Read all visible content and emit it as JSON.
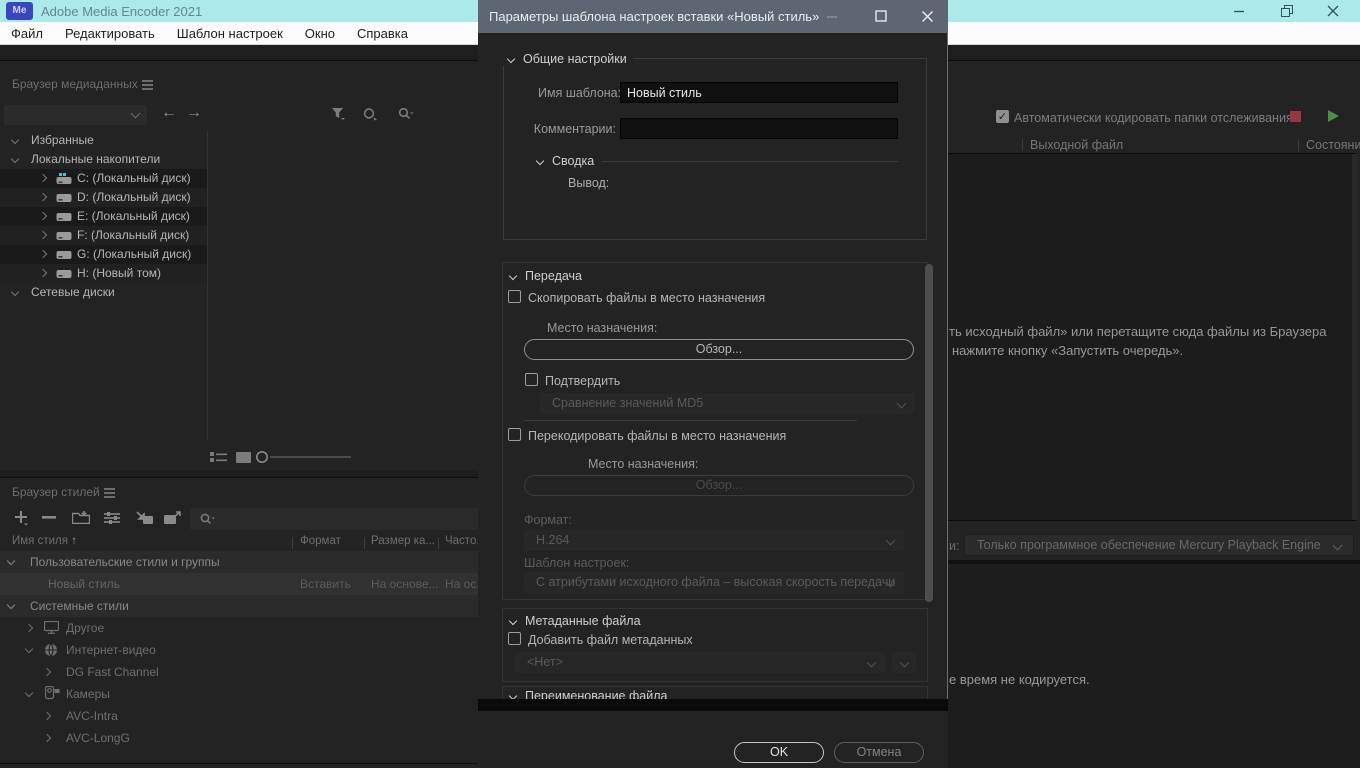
{
  "colors": {
    "titlebar_accent": "#abe9eb",
    "dialog_titlebar": "#5c6773",
    "panel_bg": "#232323",
    "stop_red": "#96393c",
    "play_green": "#4a8f46",
    "logo_blue": "#3a45c0",
    "drive_accent_cyan": "#35c8d8"
  },
  "icons": {
    "back_arrow": "←",
    "forward_arrow": "→",
    "sort_asc": "↑",
    "check": "✓"
  },
  "window": {
    "logo_text": "Me",
    "title": "Adobe Media Encoder 2021"
  },
  "menubar": {
    "items": [
      "Файл",
      "Редактировать",
      "Шаблон настроек",
      "Окно",
      "Справка"
    ]
  },
  "media_browser": {
    "title": "Браузер медиаданных",
    "tree": [
      {
        "label": "Избранные"
      },
      {
        "label": "Локальные накопители"
      },
      {
        "label": "C: (Локальный диск)"
      },
      {
        "label": "D: (Локальный диск)"
      },
      {
        "label": "E: (Локальный диск)"
      },
      {
        "label": "F: (Локальный диск)"
      },
      {
        "label": "G: (Локальный диск)"
      },
      {
        "label": "H: (Новый том)"
      },
      {
        "label": "Сетевые диски"
      }
    ]
  },
  "preset_browser": {
    "title": "Браузер стилей",
    "columns": {
      "name": "Имя стиля",
      "format": "Формат",
      "frame_size": "Размер ка...",
      "frame_rate": "Часто..."
    },
    "rows": [
      {
        "name": "Пользовательские стили и группы"
      },
      {
        "name": "Новый стиль",
        "format": "Вставить",
        "frame_size": "На основе...",
        "frame_rate": "На ос..."
      },
      {
        "name": "Системные стили"
      },
      {
        "name": "Другое"
      },
      {
        "name": "Интернет-видео"
      },
      {
        "name": "DG Fast Channel"
      },
      {
        "name": "Камеры"
      },
      {
        "name": "AVC-Intra"
      },
      {
        "name": "AVC-LongG"
      }
    ]
  },
  "queue": {
    "watch_folder_label": "Автоматически кодировать папки отслеживания",
    "col_output_file": "Выходной файл",
    "col_status": "Состояни",
    "empty_line1": "ть исходный файл» или перетащите сюда файлы из Браузера",
    "empty_line2": "нажмите кнопку «Запустить очередь».",
    "renderer_label_fragment": "и:",
    "renderer_value": "Только программное обеспечение Mercury Playback Engine",
    "bottom_note_fragment": "е время не кодируется."
  },
  "dialog": {
    "title": "Параметры шаблона настроек вставки «Новый стиль»",
    "general": {
      "header": "Общие настройки",
      "name_label": "Имя шаблона:",
      "name_value": "Новый стиль",
      "comments_label": "Комментарии:",
      "comments_value": "",
      "summary_header": "Сводка",
      "output_label": "Вывод:"
    },
    "transfer": {
      "header": "Передача",
      "copy_label": "Скопировать файлы в место назначения",
      "dest_label": "Место назначения:",
      "browse_label": "Обзор...",
      "verify_label": "Подтвердить",
      "verify_value": "Сравнение значений MD5",
      "transcode_label": "Перекодировать файлы в место назначения",
      "dest2_label": "Место назначения:",
      "browse2_label": "Обзор...",
      "format_label": "Формат:",
      "format_value": "H.264",
      "preset_label": "Шаблон настроек:",
      "preset_value": "С атрибутами исходного файла – высокая скорость передачи"
    },
    "metadata": {
      "header": "Метаданные файла",
      "add_label": "Добавить файл метаданных",
      "value": "<Нет>"
    },
    "rename": {
      "header": "Переименование файла"
    },
    "ok_label": "OK",
    "cancel_label": "Отмена"
  }
}
